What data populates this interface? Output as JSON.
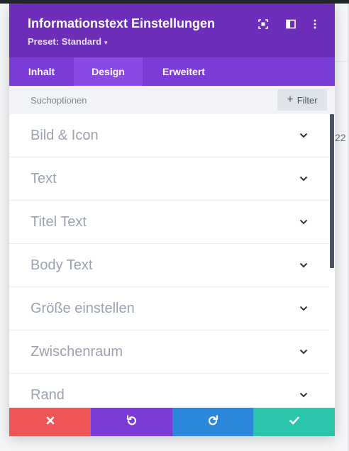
{
  "background": {
    "number": "22"
  },
  "header": {
    "title": "Informationstext Einstellungen",
    "preset": "Preset: Standard",
    "icons": [
      "focus-icon",
      "sidebar-toggle-icon",
      "more-options-icon"
    ]
  },
  "tabs": [
    {
      "label": "Inhalt",
      "active": false
    },
    {
      "label": "Design",
      "active": true
    },
    {
      "label": "Erweitert",
      "active": false
    }
  ],
  "search": {
    "label": "Suchoptionen",
    "filter_label": "Filter"
  },
  "sections": [
    {
      "label": "Bild & Icon"
    },
    {
      "label": "Text"
    },
    {
      "label": "Titel Text"
    },
    {
      "label": "Body Text"
    },
    {
      "label": "Größe einstellen"
    },
    {
      "label": "Zwischenraum"
    },
    {
      "label": "Rand"
    }
  ],
  "footer": {
    "buttons": [
      {
        "name": "discard-button",
        "icon": "close-icon",
        "color": "#ef5555"
      },
      {
        "name": "undo-button",
        "icon": "undo-icon",
        "color": "#7b3cd6"
      },
      {
        "name": "redo-button",
        "icon": "redo-icon",
        "color": "#2b87da"
      },
      {
        "name": "save-button",
        "icon": "check-icon",
        "color": "#29c4a9"
      }
    ]
  },
  "colors": {
    "header": "#6c2eb9",
    "tabs": "#7b3cd6",
    "active_tab": "#8b4ae6"
  }
}
